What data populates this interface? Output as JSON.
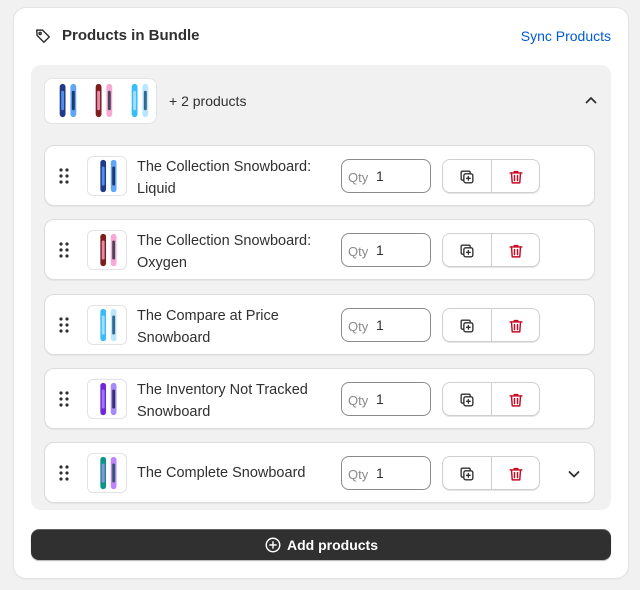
{
  "card": {
    "title": "Products in Bundle",
    "sync_label": "Sync Products",
    "tag_icon": "tag-icon"
  },
  "summary": {
    "text": "+ 2 products",
    "thumbnails": [
      "snowboard-liquid",
      "snowboard-oxygen",
      "snowboard-compare"
    ]
  },
  "qty_prefix": "Qty",
  "items": [
    {
      "name": "The Collection Snowboard: Liquid",
      "qty": "1",
      "colors": [
        "#1e3a8a",
        "#60a5fa",
        "#0b1d4a"
      ]
    },
    {
      "name": "The Collection Snowboard: Oxygen",
      "qty": "1",
      "colors": [
        "#7f1d1d",
        "#f9a8d4",
        "#1e293b"
      ]
    },
    {
      "name": "The Compare at Price Snowboard",
      "qty": "1",
      "colors": [
        "#38bdf8",
        "#bae6fd",
        "#0c4a6e"
      ]
    },
    {
      "name": "The Inventory Not Tracked Snowboard",
      "qty": "1",
      "colors": [
        "#6d28d9",
        "#a78bfa",
        "#1e1b4b"
      ]
    },
    {
      "name": "The Complete Snowboard",
      "qty": "1",
      "colors": [
        "#0d9488",
        "#c084fc",
        "#134e4a"
      ]
    }
  ],
  "add_button": {
    "label": "Add products"
  },
  "colors": {
    "link": "#005bd3",
    "delete": "#c70a24",
    "primary_button": "#303030"
  }
}
